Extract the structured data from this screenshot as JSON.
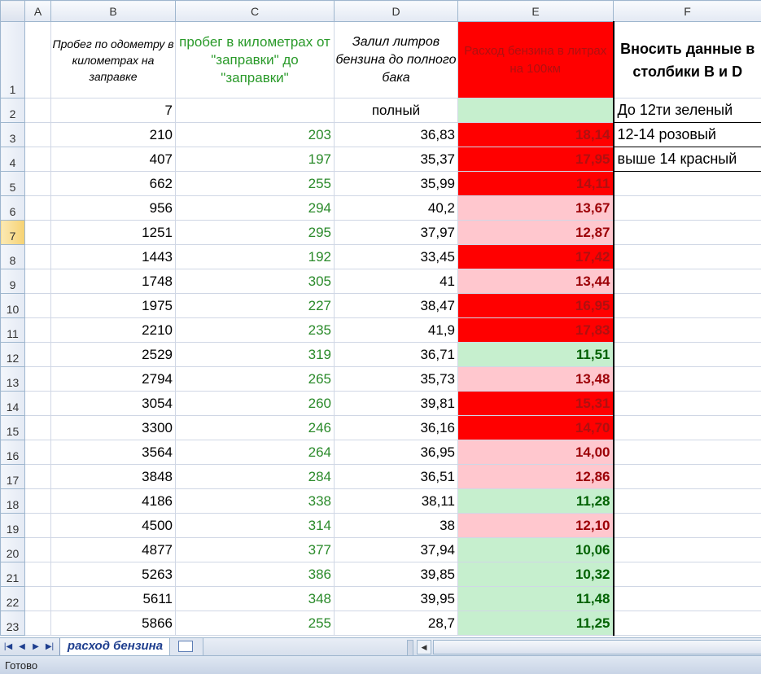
{
  "columns": [
    "A",
    "B",
    "C",
    "D",
    "E",
    "F"
  ],
  "header": {
    "row": "1",
    "b": "Пробег по одометру в километрах на заправке",
    "c": "пробег в километрах от \"заправки\" до \"заправки\"",
    "d": "Залил литров бензина до полного бака",
    "e": "Расход бензина в литрах на 100км",
    "f": "Вносить данные в столбики B и D"
  },
  "row2": {
    "row": "2",
    "b": "7",
    "d": "полный",
    "f": "До 12ти зеленый"
  },
  "notes": [
    "12-14 розовый",
    "выше 14 красный"
  ],
  "rows": [
    {
      "row": "3",
      "b": "210",
      "c": "203",
      "d": "36,83",
      "e": "18,14",
      "lvl": "red"
    },
    {
      "row": "4",
      "b": "407",
      "c": "197",
      "d": "35,37",
      "e": "17,95",
      "lvl": "red"
    },
    {
      "row": "5",
      "b": "662",
      "c": "255",
      "d": "35,99",
      "e": "14,11",
      "lvl": "red"
    },
    {
      "row": "6",
      "b": "956",
      "c": "294",
      "d": "40,2",
      "e": "13,67",
      "lvl": "pink"
    },
    {
      "row": "7",
      "b": "1251",
      "c": "295",
      "d": "37,97",
      "e": "12,87",
      "lvl": "pink"
    },
    {
      "row": "8",
      "b": "1443",
      "c": "192",
      "d": "33,45",
      "e": "17,42",
      "lvl": "red"
    },
    {
      "row": "9",
      "b": "1748",
      "c": "305",
      "d": "41",
      "e": "13,44",
      "lvl": "pink"
    },
    {
      "row": "10",
      "b": "1975",
      "c": "227",
      "d": "38,47",
      "e": "16,95",
      "lvl": "red"
    },
    {
      "row": "11",
      "b": "2210",
      "c": "235",
      "d": "41,9",
      "e": "17,83",
      "lvl": "red"
    },
    {
      "row": "12",
      "b": "2529",
      "c": "319",
      "d": "36,71",
      "e": "11,51",
      "lvl": "green"
    },
    {
      "row": "13",
      "b": "2794",
      "c": "265",
      "d": "35,73",
      "e": "13,48",
      "lvl": "pink"
    },
    {
      "row": "14",
      "b": "3054",
      "c": "260",
      "d": "39,81",
      "e": "15,31",
      "lvl": "red"
    },
    {
      "row": "15",
      "b": "3300",
      "c": "246",
      "d": "36,16",
      "e": "14,70",
      "lvl": "red"
    },
    {
      "row": "16",
      "b": "3564",
      "c": "264",
      "d": "36,95",
      "e": "14,00",
      "lvl": "pink"
    },
    {
      "row": "17",
      "b": "3848",
      "c": "284",
      "d": "36,51",
      "e": "12,86",
      "lvl": "pink"
    },
    {
      "row": "18",
      "b": "4186",
      "c": "338",
      "d": "38,11",
      "e": "11,28",
      "lvl": "green"
    },
    {
      "row": "19",
      "b": "4500",
      "c": "314",
      "d": "38",
      "e": "12,10",
      "lvl": "pink"
    },
    {
      "row": "20",
      "b": "4877",
      "c": "377",
      "d": "37,94",
      "e": "10,06",
      "lvl": "green"
    },
    {
      "row": "21",
      "b": "5263",
      "c": "386",
      "d": "39,85",
      "e": "10,32",
      "lvl": "green"
    },
    {
      "row": "22",
      "b": "5611",
      "c": "348",
      "d": "39,95",
      "e": "11,48",
      "lvl": "green"
    },
    {
      "row": "23",
      "b": "5866",
      "c": "255",
      "d": "28,7",
      "e": "11,25",
      "lvl": "green"
    }
  ],
  "selected_row": "7",
  "sheet_tab": "расход бензина",
  "status": "Готово",
  "colors": {
    "red": "#ff0000",
    "pink": "#ffc7ce",
    "green": "#c6efce"
  }
}
